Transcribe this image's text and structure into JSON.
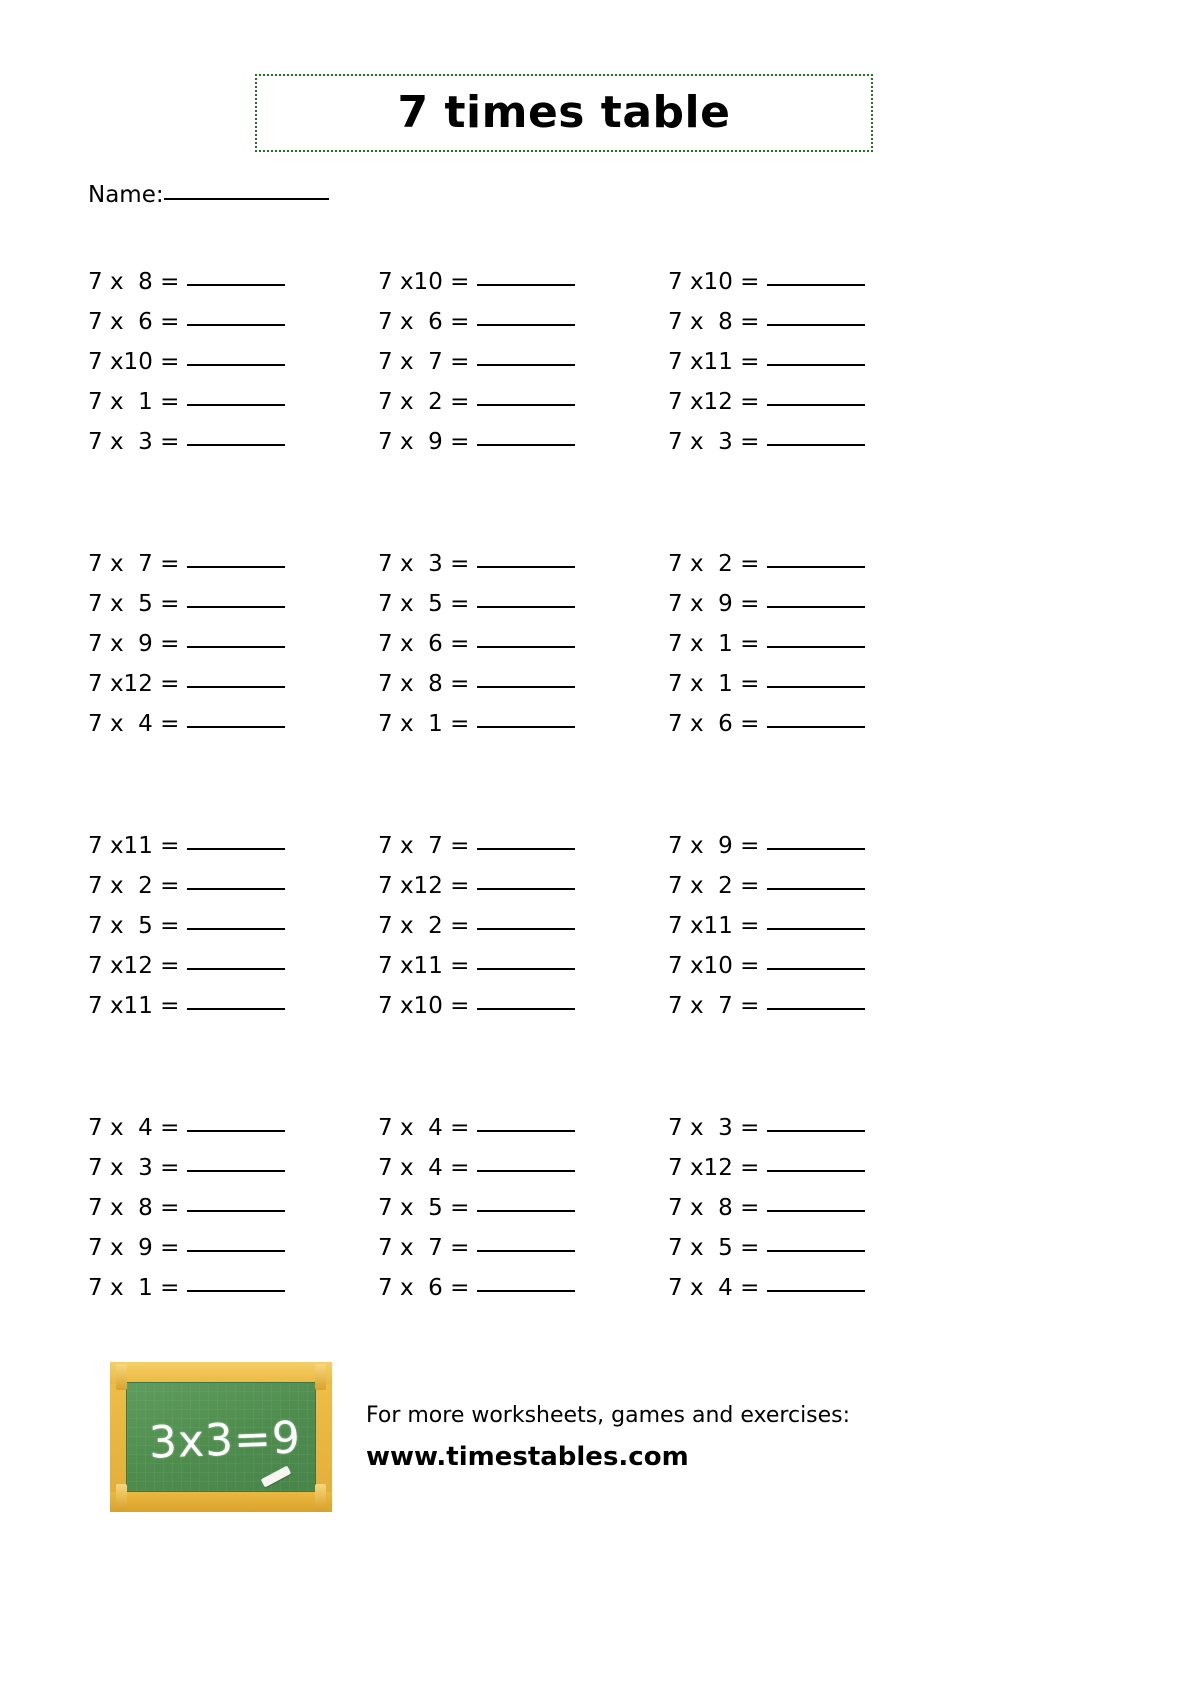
{
  "page": {
    "title": "7 times table",
    "title_border_color": "#1a7a1a"
  },
  "name_field": {
    "label": "Name:",
    "value": ""
  },
  "problems": {
    "operand_left": "7",
    "operator": "x",
    "equals": "=",
    "blocks": [
      {
        "rows": [
          {
            "cells": [
              "7 x  8 =",
              "7 x10 =",
              "7 x10 ="
            ]
          },
          {
            "cells": [
              "7 x  6 =",
              "7 x  6 =",
              "7 x  8 ="
            ]
          },
          {
            "cells": [
              "7 x10 =",
              "7 x  7 =",
              "7 x11 ="
            ]
          },
          {
            "cells": [
              "7 x  1 =",
              "7 x  2 =",
              "7 x12 ="
            ]
          },
          {
            "cells": [
              "7 x  3 =",
              "7 x  9 =",
              "7 x  3 ="
            ]
          }
        ]
      },
      {
        "rows": [
          {
            "cells": [
              "7 x  7 =",
              "7 x  3 =",
              "7 x  2 ="
            ]
          },
          {
            "cells": [
              "7 x  5 =",
              "7 x  5 =",
              "7 x  9 ="
            ]
          },
          {
            "cells": [
              "7 x  9 =",
              "7 x  6 =",
              "7 x  1 ="
            ]
          },
          {
            "cells": [
              "7 x12 =",
              "7 x  8 =",
              "7 x  1 ="
            ]
          },
          {
            "cells": [
              "7 x  4 =",
              "7 x  1 =",
              "7 x  6 ="
            ]
          }
        ]
      },
      {
        "rows": [
          {
            "cells": [
              "7 x11 =",
              "7 x  7 =",
              "7 x  9 ="
            ]
          },
          {
            "cells": [
              "7 x  2 =",
              "7 x12 =",
              "7 x  2 ="
            ]
          },
          {
            "cells": [
              "7 x  5 =",
              "7 x  2 =",
              "7 x11 ="
            ]
          },
          {
            "cells": [
              "7 x12 =",
              "7 x11 =",
              "7 x10 ="
            ]
          },
          {
            "cells": [
              "7 x11 =",
              "7 x10 =",
              "7 x  7 ="
            ]
          }
        ]
      },
      {
        "rows": [
          {
            "cells": [
              "7 x  4 =",
              "7 x  4 =",
              "7 x  3 ="
            ]
          },
          {
            "cells": [
              "7 x  3 =",
              "7 x  4 =",
              "7 x12 ="
            ]
          },
          {
            "cells": [
              "7 x  8 =",
              "7 x  5 =",
              "7 x  8 ="
            ]
          },
          {
            "cells": [
              "7 x  9 =",
              "7 x  7 =",
              "7 x  5 ="
            ]
          },
          {
            "cells": [
              "7 x  1 =",
              "7 x  6 =",
              "7 x  4 ="
            ]
          }
        ]
      }
    ]
  },
  "footer": {
    "logo_equation": "3x3=9",
    "logo_board_color": "#4e8c4e",
    "logo_frame_color": "#e6b53c",
    "line1": "For more worksheets, games and exercises:",
    "line2": "www.timestables.com"
  }
}
